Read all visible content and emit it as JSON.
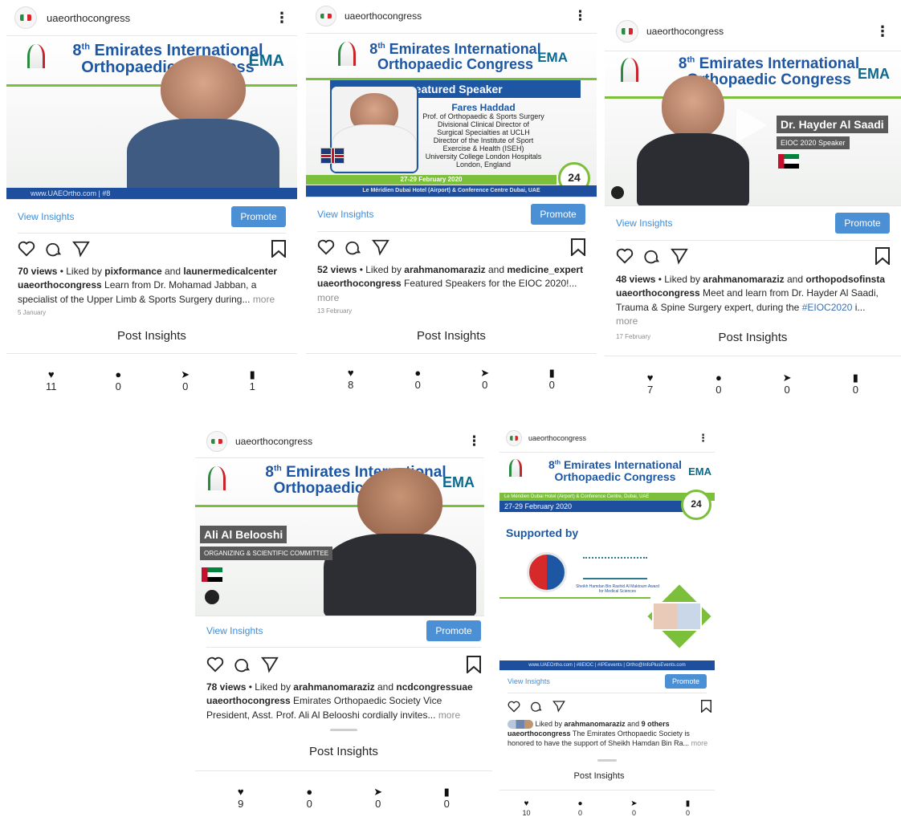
{
  "account": "uaeorthocongress",
  "menu_glyph": "⋮",
  "view_insights": "View Insights",
  "promote": "Promote",
  "post_insights": "Post Insights",
  "banner": {
    "line1": "8",
    "sup": "th",
    "line1b": " Emirates International",
    "line2": "Orthopaedic Congress",
    "logo": "EMA"
  },
  "colors": {
    "accent": "#3d8ed9",
    "promote_bg": "#4b8fd4",
    "banner_blue": "#1d57a3",
    "green": "#7bbf3a"
  },
  "icons": [
    "heart-icon",
    "comment-icon",
    "share-icon",
    "bookmark-icon"
  ],
  "posts": [
    {
      "views": "70 views",
      "liked_by_prefix": " • Liked by ",
      "liker1": "pixformance",
      "and": " and ",
      "liker2": "launermedicalcenter",
      "caption": "Learn from Dr. Mohamad Jabban, a specialist of the Upper Limb & Sports Surgery during",
      "ellipsis": "... ",
      "more": "more",
      "date": "5 January",
      "image_footer": "www.UAEOrtho.com | #8",
      "stats": {
        "likes": "11",
        "comments": "0",
        "shares": "0",
        "saves": "1"
      }
    },
    {
      "views": "52 views",
      "liked_by_prefix": " • Liked by ",
      "liker1": "arahmanomaraziz",
      "and": " and ",
      "liker2": "medicine_expert",
      "caption": "Featured Speakers for the EIOC 2020!",
      "ellipsis": "... ",
      "more": "more",
      "date": "13 February",
      "featured": "Featured Speaker",
      "speaker_name": "Fares Haddad",
      "speaker_lines": [
        "Prof. of Orthopaedic & Sports Surgery",
        "Divisional Clinical Director of",
        "Surgical Specialties at UCLH",
        "Director of the Institute of Sport",
        "Exercise & Health (ISEH)",
        "University College London Hospitals",
        "London, England"
      ],
      "dates_bar": "27-29 February 2020",
      "venue_bar": "Le Méridien Dubai Hotel (Airport) & Conference Centre Dubai, UAE",
      "cpd": "24",
      "stats": {
        "likes": "8",
        "comments": "0",
        "shares": "0",
        "saves": "0"
      }
    },
    {
      "views": "48 views",
      "liked_by_prefix": " • Liked by ",
      "liker1": "arahmanomaraziz",
      "and": " and ",
      "liker2": "orthopodsofinsta",
      "caption": "Meet and learn from Dr. Hayder Al Saadi, Trauma & Spine Surgery expert, during the ",
      "hashtag": "#EIOC2020",
      "trunc": " i",
      "ellipsis": "... ",
      "more": "more",
      "date": "17 February",
      "speaker_name": "Dr. Hayder Al Saadi",
      "speaker_role": "EIOC 2020 Speaker",
      "stats": {
        "likes": "7",
        "comments": "0",
        "shares": "0",
        "saves": "0"
      }
    },
    {
      "views": "78 views",
      "liked_by_prefix": " • Liked by ",
      "liker1": "arahmanomaraziz",
      "and": " and ",
      "liker2": "ncdcongressuae",
      "caption": "Emirates Orthopaedic Society Vice President, Asst. Prof. Ali Al Belooshi cordially invites",
      "ellipsis": "... ",
      "more": "more",
      "speaker_name": "Ali Al Belooshi",
      "speaker_role": "ORGANIZING & SCIENTIFIC COMMITTEE",
      "stats": {
        "likes": "9",
        "comments": "0",
        "shares": "0",
        "saves": "0"
      }
    },
    {
      "liked_by_prefix": "Liked by ",
      "liker1": "arahmanomaraziz",
      "and": " and ",
      "liker2": "9 others",
      "caption": "The Emirates Orthopaedic Society is honored to have the support of Sheikh Hamdan Bin Ra",
      "ellipsis": "... ",
      "more": "more",
      "venue_bar": "Le Méridien Dubai Hotel (Airport) & Conference Centre, Dubai, UAE",
      "dates_bar": "27-29 February 2020",
      "cpd": "24",
      "supported_by": "Supported by",
      "sponsor_caption": "Sheikh Hamdan Bin Rashid Al Maktoum Award for Medical Sciences",
      "image_footer": "www.UAEOrtho.com | #8EIOC | #IPEevents | Ortho@InfoPlusEvents.com",
      "stats": {
        "likes": "10",
        "comments": "0",
        "shares": "0",
        "saves": "0"
      }
    }
  ]
}
